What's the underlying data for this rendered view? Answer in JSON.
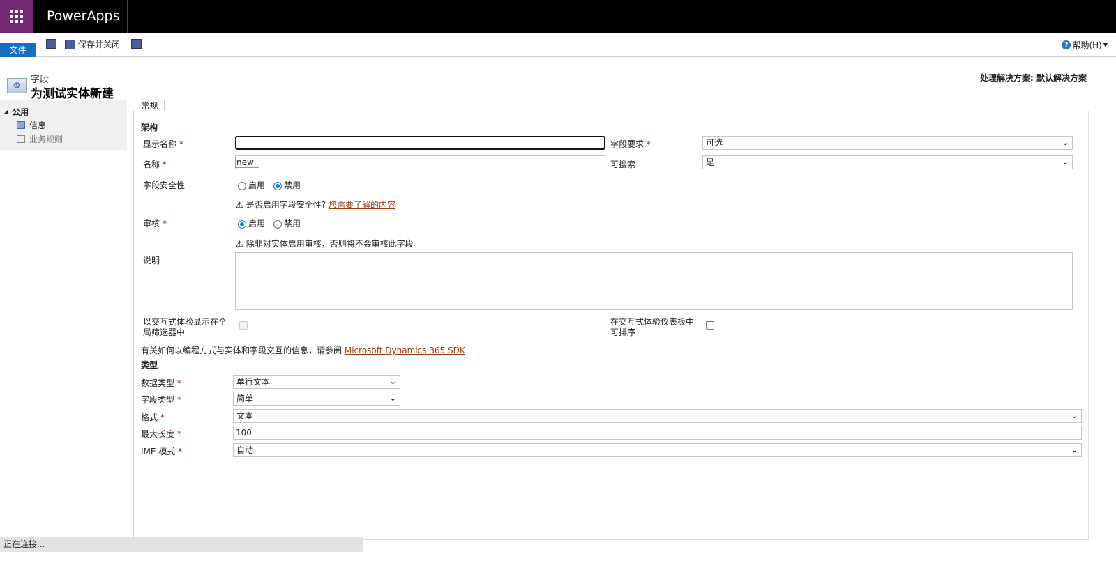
{
  "app": {
    "name": "PowerApps"
  },
  "toolbar": {
    "file": "文件",
    "save_close": "保存并关闭",
    "help": "帮助(H)"
  },
  "header": {
    "solution": "处理解决方案: 默认解决方案",
    "breadcrumb": "字段",
    "title": "为测试实体新建"
  },
  "nav": {
    "group": "公用",
    "items": [
      "信息",
      "业务规则"
    ]
  },
  "tab": "常规",
  "schema": {
    "section": "架构",
    "display_name": {
      "label": "显示名称",
      "value": ""
    },
    "name": {
      "label": "名称",
      "value": "new_"
    },
    "field_requirement": {
      "label": "字段要求",
      "value": "可选"
    },
    "searchable": {
      "label": "可搜索",
      "value": "是"
    },
    "field_security": {
      "label": "字段安全性",
      "options": [
        "启用",
        "禁用"
      ],
      "selected": "禁用",
      "warning": "是否启用字段安全性?",
      "link": "您需要了解的内容"
    },
    "auditing": {
      "label": "审核",
      "options": [
        "启用",
        "禁用"
      ],
      "selected": "启用",
      "warning": "除非对实体启用审核，否则将不会审核此字段。"
    },
    "description": {
      "label": "说明",
      "value": ""
    },
    "global_filter": {
      "label": "以交互式体验显示在全局筛选器中",
      "checked": false
    },
    "sortable": {
      "label": "在交互式体验仪表板中可排序",
      "checked": false
    },
    "sdk_text": "有关如何以编程方式与实体和字段交互的信息，请参阅",
    "sdk_link": "Microsoft Dynamics 365 SDK"
  },
  "type": {
    "section": "类型",
    "data_type": {
      "label": "数据类型",
      "value": "单行文本"
    },
    "field_type": {
      "label": "字段类型",
      "value": "简单"
    },
    "format": {
      "label": "格式",
      "value": "文本"
    },
    "max_length": {
      "label": "最大长度",
      "value": "100"
    },
    "ime_mode": {
      "label": "IME 模式",
      "value": "自动"
    }
  },
  "status": "正在连接..."
}
